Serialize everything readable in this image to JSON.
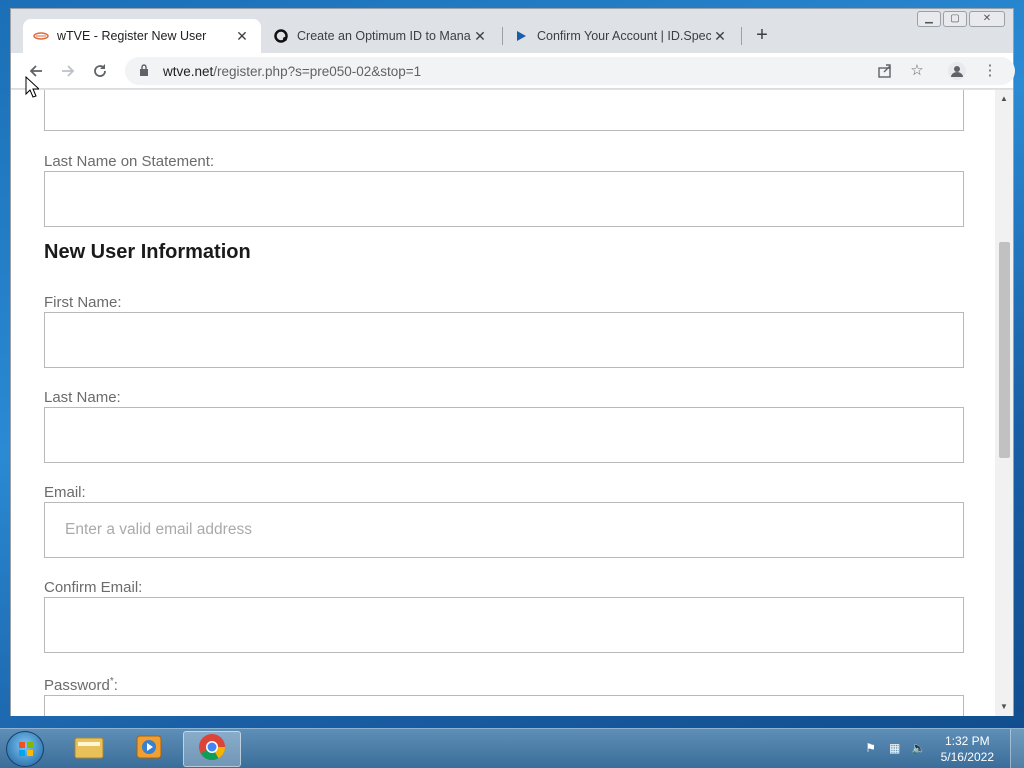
{
  "browser": {
    "tabs": [
      {
        "title": "wTVE - Register New User",
        "icon": "wtve-logo-icon"
      },
      {
        "title": "Create an Optimum ID to Manag",
        "icon": "optimum-logo-icon"
      },
      {
        "title": "Confirm Your Account | ID.Spectr",
        "icon": "spectrum-play-icon"
      }
    ],
    "url_domain": "wtve.net",
    "url_path": "/register.php?s=pre050-02&stop=1"
  },
  "form": {
    "last_name_statement_label": "Last Name on Statement:",
    "section_title": "New User Information",
    "first_name_label": "First Name:",
    "last_name_label": "Last Name:",
    "email_label": "Email:",
    "email_placeholder": "Enter a valid email address",
    "confirm_email_label": "Confirm Email:",
    "password_label": "Password",
    "password_marker": "*",
    "password_colon": ":"
  },
  "taskbar": {
    "time": "1:32 PM",
    "date": "5/16/2022"
  }
}
